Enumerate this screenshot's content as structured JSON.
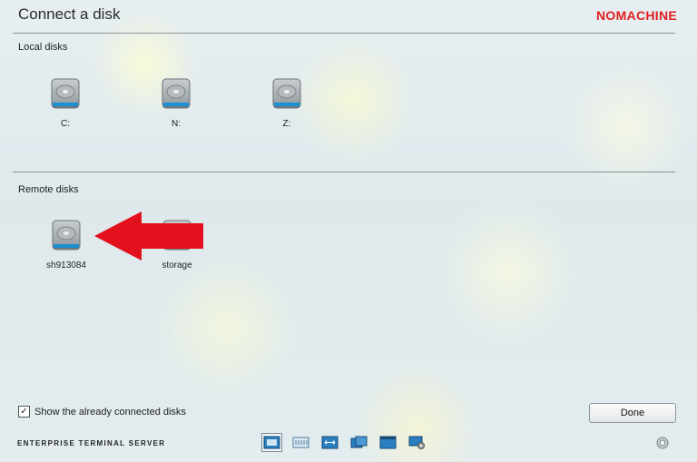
{
  "header": {
    "title": "Connect a disk",
    "logo": "NOMACHINE"
  },
  "local": {
    "label": "Local disks",
    "disks": [
      {
        "label": "C:"
      },
      {
        "label": "N:"
      },
      {
        "label": "Z:"
      }
    ]
  },
  "remote": {
    "label": "Remote disks",
    "disks": [
      {
        "label": "sh913084"
      },
      {
        "label": "storage"
      }
    ]
  },
  "footer": {
    "show_connected_label": "Show the already connected disks",
    "show_connected_checked": true,
    "check_mark": "✓",
    "done_label": "Done",
    "product_text": "ENTERPRISE TERMINAL SERVER"
  },
  "toolbar": {
    "icons": [
      "fullscreen-icon",
      "keyboard-icon",
      "resize-icon",
      "display-icon",
      "window-icon",
      "monitor-settings-icon"
    ]
  },
  "colors": {
    "logo": "#e02020",
    "arrow": "#e3101d",
    "drive_accent": "#1a8fd4"
  }
}
